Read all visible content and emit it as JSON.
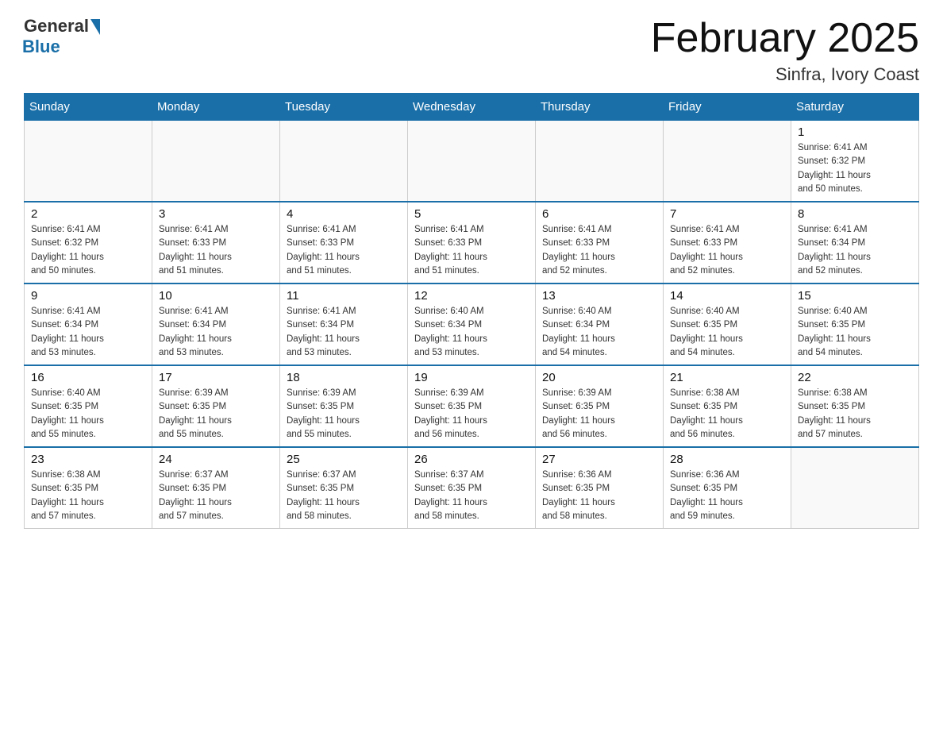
{
  "header": {
    "logo_general": "General",
    "logo_blue": "Blue",
    "title": "February 2025",
    "subtitle": "Sinfra, Ivory Coast"
  },
  "days_of_week": [
    "Sunday",
    "Monday",
    "Tuesday",
    "Wednesday",
    "Thursday",
    "Friday",
    "Saturday"
  ],
  "weeks": [
    [
      {
        "day": "",
        "info": ""
      },
      {
        "day": "",
        "info": ""
      },
      {
        "day": "",
        "info": ""
      },
      {
        "day": "",
        "info": ""
      },
      {
        "day": "",
        "info": ""
      },
      {
        "day": "",
        "info": ""
      },
      {
        "day": "1",
        "info": "Sunrise: 6:41 AM\nSunset: 6:32 PM\nDaylight: 11 hours\nand 50 minutes."
      }
    ],
    [
      {
        "day": "2",
        "info": "Sunrise: 6:41 AM\nSunset: 6:32 PM\nDaylight: 11 hours\nand 50 minutes."
      },
      {
        "day": "3",
        "info": "Sunrise: 6:41 AM\nSunset: 6:33 PM\nDaylight: 11 hours\nand 51 minutes."
      },
      {
        "day": "4",
        "info": "Sunrise: 6:41 AM\nSunset: 6:33 PM\nDaylight: 11 hours\nand 51 minutes."
      },
      {
        "day": "5",
        "info": "Sunrise: 6:41 AM\nSunset: 6:33 PM\nDaylight: 11 hours\nand 51 minutes."
      },
      {
        "day": "6",
        "info": "Sunrise: 6:41 AM\nSunset: 6:33 PM\nDaylight: 11 hours\nand 52 minutes."
      },
      {
        "day": "7",
        "info": "Sunrise: 6:41 AM\nSunset: 6:33 PM\nDaylight: 11 hours\nand 52 minutes."
      },
      {
        "day": "8",
        "info": "Sunrise: 6:41 AM\nSunset: 6:34 PM\nDaylight: 11 hours\nand 52 minutes."
      }
    ],
    [
      {
        "day": "9",
        "info": "Sunrise: 6:41 AM\nSunset: 6:34 PM\nDaylight: 11 hours\nand 53 minutes."
      },
      {
        "day": "10",
        "info": "Sunrise: 6:41 AM\nSunset: 6:34 PM\nDaylight: 11 hours\nand 53 minutes."
      },
      {
        "day": "11",
        "info": "Sunrise: 6:41 AM\nSunset: 6:34 PM\nDaylight: 11 hours\nand 53 minutes."
      },
      {
        "day": "12",
        "info": "Sunrise: 6:40 AM\nSunset: 6:34 PM\nDaylight: 11 hours\nand 53 minutes."
      },
      {
        "day": "13",
        "info": "Sunrise: 6:40 AM\nSunset: 6:34 PM\nDaylight: 11 hours\nand 54 minutes."
      },
      {
        "day": "14",
        "info": "Sunrise: 6:40 AM\nSunset: 6:35 PM\nDaylight: 11 hours\nand 54 minutes."
      },
      {
        "day": "15",
        "info": "Sunrise: 6:40 AM\nSunset: 6:35 PM\nDaylight: 11 hours\nand 54 minutes."
      }
    ],
    [
      {
        "day": "16",
        "info": "Sunrise: 6:40 AM\nSunset: 6:35 PM\nDaylight: 11 hours\nand 55 minutes."
      },
      {
        "day": "17",
        "info": "Sunrise: 6:39 AM\nSunset: 6:35 PM\nDaylight: 11 hours\nand 55 minutes."
      },
      {
        "day": "18",
        "info": "Sunrise: 6:39 AM\nSunset: 6:35 PM\nDaylight: 11 hours\nand 55 minutes."
      },
      {
        "day": "19",
        "info": "Sunrise: 6:39 AM\nSunset: 6:35 PM\nDaylight: 11 hours\nand 56 minutes."
      },
      {
        "day": "20",
        "info": "Sunrise: 6:39 AM\nSunset: 6:35 PM\nDaylight: 11 hours\nand 56 minutes."
      },
      {
        "day": "21",
        "info": "Sunrise: 6:38 AM\nSunset: 6:35 PM\nDaylight: 11 hours\nand 56 minutes."
      },
      {
        "day": "22",
        "info": "Sunrise: 6:38 AM\nSunset: 6:35 PM\nDaylight: 11 hours\nand 57 minutes."
      }
    ],
    [
      {
        "day": "23",
        "info": "Sunrise: 6:38 AM\nSunset: 6:35 PM\nDaylight: 11 hours\nand 57 minutes."
      },
      {
        "day": "24",
        "info": "Sunrise: 6:37 AM\nSunset: 6:35 PM\nDaylight: 11 hours\nand 57 minutes."
      },
      {
        "day": "25",
        "info": "Sunrise: 6:37 AM\nSunset: 6:35 PM\nDaylight: 11 hours\nand 58 minutes."
      },
      {
        "day": "26",
        "info": "Sunrise: 6:37 AM\nSunset: 6:35 PM\nDaylight: 11 hours\nand 58 minutes."
      },
      {
        "day": "27",
        "info": "Sunrise: 6:36 AM\nSunset: 6:35 PM\nDaylight: 11 hours\nand 58 minutes."
      },
      {
        "day": "28",
        "info": "Sunrise: 6:36 AM\nSunset: 6:35 PM\nDaylight: 11 hours\nand 59 minutes."
      },
      {
        "day": "",
        "info": ""
      }
    ]
  ]
}
